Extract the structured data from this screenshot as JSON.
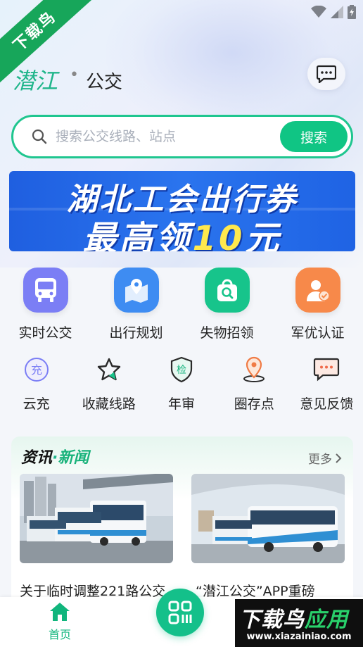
{
  "watermark": {
    "corner": "下载鸟",
    "brand_a": "下载鸟",
    "brand_b": "应用",
    "url": "www.xiazainiao.com"
  },
  "header": {
    "logo_a": "潜江",
    "logo_dot": "•",
    "logo_b": "公交",
    "message_icon": "chat-bubble-icon"
  },
  "search": {
    "placeholder": "搜索公交线路、站点",
    "value": "",
    "button": "搜索"
  },
  "banner": {
    "line1": "湖北工会出行券",
    "line2_prefix": "最高领",
    "line2_number": "10",
    "line2_suffix": "元"
  },
  "grid_primary": [
    {
      "label": "实时公交",
      "icon": "bus-icon",
      "color": "#7b7ef5"
    },
    {
      "label": "出行规划",
      "icon": "map-pin-icon",
      "color": "#3e8cf2"
    },
    {
      "label": "失物招领",
      "icon": "lost-found-bag-icon",
      "color": "#17c48b"
    },
    {
      "label": "军优认证",
      "icon": "military-cert-icon",
      "color": "#f7894a"
    }
  ],
  "grid_secondary": [
    {
      "label": "云充",
      "icon": "recharge-icon",
      "glyph": "充"
    },
    {
      "label": "收藏线路",
      "icon": "star-icon"
    },
    {
      "label": "年审",
      "icon": "shield-check-icon",
      "glyph": "检"
    },
    {
      "label": "圈存点",
      "icon": "location-icon"
    },
    {
      "label": "意见反馈",
      "icon": "feedback-icon"
    }
  ],
  "news": {
    "title_a": "资讯",
    "title_dot": "·",
    "title_b": "新闻",
    "more": "更多",
    "items": [
      {
        "text": "关于临时调整221路公交"
      },
      {
        "text": "“潜江公交”APP重磅"
      }
    ]
  },
  "tabbar": {
    "home": "首页",
    "scan_icon": "scan-icon"
  },
  "colors": {
    "accent": "#10c584",
    "banner": "#2a6fec"
  }
}
